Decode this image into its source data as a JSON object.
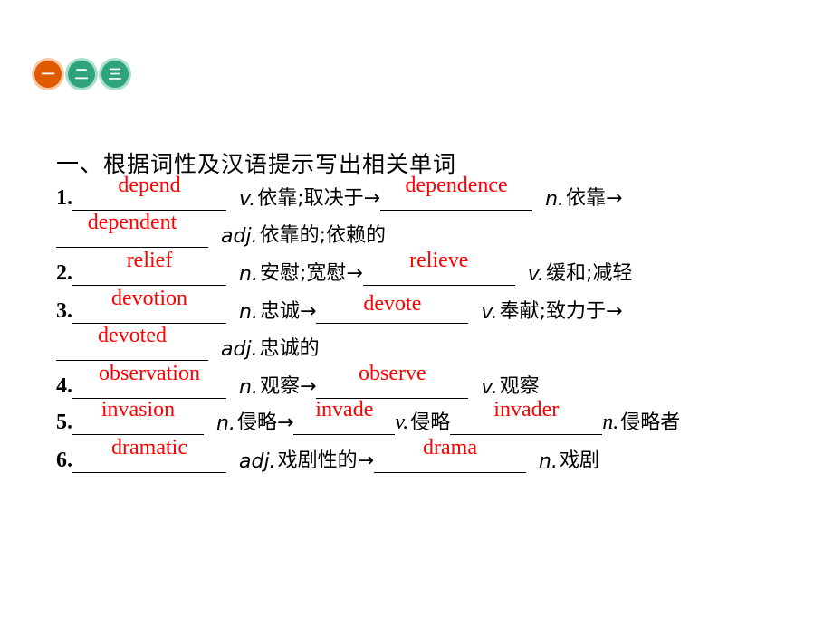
{
  "nav": {
    "items": [
      {
        "label": "一",
        "active": true
      },
      {
        "label": "二",
        "active": false
      },
      {
        "label": "三",
        "active": false
      }
    ],
    "colors": {
      "active": "#e05a00",
      "normal": "#2fa37c"
    }
  },
  "heading": "一、根据词性及汉语提示写出相关单词",
  "answer_color": "#ff0000",
  "items": {
    "1": {
      "num": "1.",
      "a1": "depend",
      "pos1": "v.",
      "cn1": "依靠;取决于→",
      "a2": "dependence",
      "pos2": "n.",
      "cn2": "依靠→",
      "a3": "dependent",
      "pos3": "adj.",
      "cn3": "依靠的;依赖的"
    },
    "2": {
      "num": "2.",
      "a1": "relief",
      "pos1": "n.",
      "cn1": "安慰;宽慰→",
      "a2": "relieve",
      "pos2": "v.",
      "cn2": "缓和;减轻"
    },
    "3": {
      "num": "3.",
      "a1": "devotion",
      "pos1": "n.",
      "cn1": "忠诚→",
      "a2": "devote",
      "pos2": "v.",
      "cn2": "奉献;致力于→",
      "a3": "devoted",
      "pos3": "adj.",
      "cn3": "忠诚的"
    },
    "4": {
      "num": "4.",
      "a1": "observation",
      "pos1": "n.",
      "cn1": "观察→",
      "a2": "observe",
      "pos2": "v.",
      "cn2": "观察"
    },
    "5": {
      "num": "5.",
      "a1": "invasion",
      "pos1": "n.",
      "cn1": "侵略→",
      "a2": "invade",
      "pos2": "v.",
      "cn2": "侵略",
      "a3": "invader",
      "pos3": "n.",
      "cn3": "侵略者"
    },
    "6": {
      "num": "6.",
      "a1": "dramatic",
      "pos1": "adj.",
      "cn1": "戏剧性的→",
      "a2": "drama",
      "pos2": "n.",
      "cn2": "戏剧"
    }
  }
}
